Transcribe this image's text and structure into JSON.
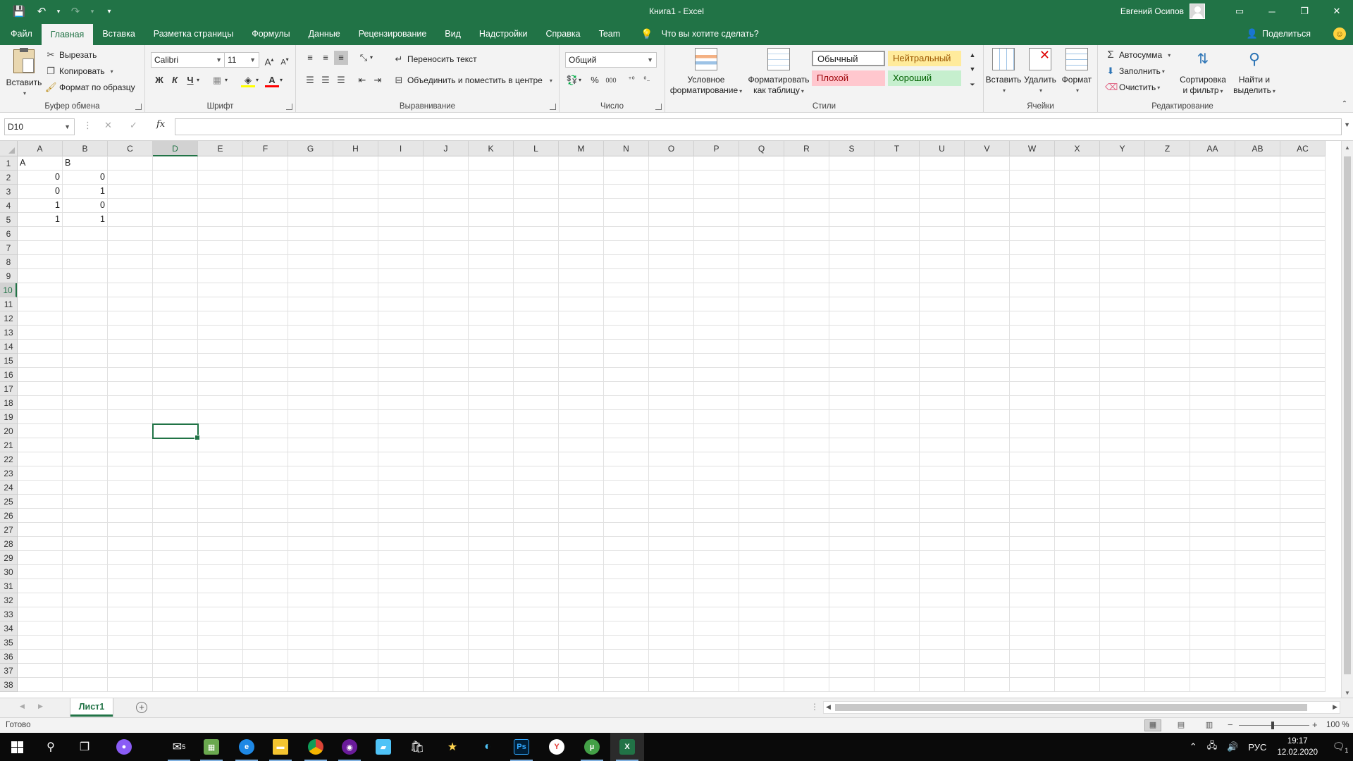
{
  "window": {
    "title": "Книга1  -  Excel",
    "user": "Евгений Осипов",
    "minimize": "─",
    "restore": "❐",
    "close": "✕",
    "ribbon_display": "▭"
  },
  "qat": {
    "save": "💾",
    "undo": "↶",
    "undo_dd": "▾",
    "redo": "↷",
    "redo_dd": "▾",
    "customize": "▾"
  },
  "tabs": [
    "Файл",
    "Главная",
    "Вставка",
    "Разметка страницы",
    "Формулы",
    "Данные",
    "Рецензирование",
    "Вид",
    "Надстройки",
    "Справка",
    "Team"
  ],
  "active_tab": "Главная",
  "tell_me": "Что вы хотите сделать?",
  "share": "Поделиться",
  "ribbon": {
    "clipboard": {
      "label": "Буфер обмена",
      "paste": "Вставить",
      "cut": "Вырезать",
      "copy": "Копировать",
      "format_painter": "Формат по образцу"
    },
    "font": {
      "label": "Шрифт",
      "name": "Calibri",
      "size": "11",
      "grow": "A",
      "shrink": "A",
      "bold": "Ж",
      "italic": "К",
      "underline": "Ч",
      "font_color_letter": "A"
    },
    "alignment": {
      "label": "Выравнивание",
      "wrap": "Переносить текст",
      "merge": "Объединить и поместить в центре"
    },
    "number": {
      "label": "Число",
      "format": "Общий",
      "percent": "%",
      "thousands": "000"
    },
    "styles": {
      "label": "Стили",
      "conditional": [
        "Условное",
        "форматирование"
      ],
      "as_table": [
        "Форматировать",
        "как таблицу"
      ],
      "normal": "Обычный",
      "neutral": "Нейтральный",
      "bad": "Плохой",
      "good": "Хороший",
      "colors": {
        "neutral_bg": "#ffeb9c",
        "neutral_fg": "#9c5700",
        "bad_bg": "#ffc7ce",
        "bad_fg": "#9c0006",
        "good_bg": "#c6efce",
        "good_fg": "#006100"
      }
    },
    "cells": {
      "label": "Ячейки",
      "insert": "Вставить",
      "delete": "Удалить",
      "format": "Формат"
    },
    "editing": {
      "label": "Редактирование",
      "autosum": "Автосумма",
      "fill": "Заполнить",
      "clear": "Очистить",
      "sort": [
        "Сортировка",
        "и фильтр"
      ],
      "find": [
        "Найти и",
        "выделить"
      ]
    }
  },
  "formula_bar": {
    "name_box": "D10",
    "fx": "fx",
    "value": ""
  },
  "columns": [
    "A",
    "B",
    "C",
    "D",
    "E",
    "F",
    "G",
    "H",
    "I",
    "J",
    "K",
    "L",
    "M",
    "N",
    "O",
    "P",
    "Q",
    "R",
    "S",
    "T",
    "U",
    "V",
    "W",
    "X",
    "Y",
    "Z",
    "AA",
    "AB",
    "AC"
  ],
  "selected_column": "D",
  "selected_row": 10,
  "row_count": 38,
  "cells": [
    {
      "row": 1,
      "col": 0,
      "value": "A",
      "num": false
    },
    {
      "row": 1,
      "col": 1,
      "value": "B",
      "num": false
    },
    {
      "row": 2,
      "col": 0,
      "value": "0",
      "num": true
    },
    {
      "row": 2,
      "col": 1,
      "value": "0",
      "num": true
    },
    {
      "row": 3,
      "col": 0,
      "value": "0",
      "num": true
    },
    {
      "row": 3,
      "col": 1,
      "value": "1",
      "num": true
    },
    {
      "row": 4,
      "col": 0,
      "value": "1",
      "num": true
    },
    {
      "row": 4,
      "col": 1,
      "value": "0",
      "num": true
    },
    {
      "row": 5,
      "col": 0,
      "value": "1",
      "num": true
    },
    {
      "row": 5,
      "col": 1,
      "value": "1",
      "num": true
    }
  ],
  "sheet_tab": "Лист1",
  "status": {
    "text": "Готово",
    "zoom": "100 %"
  },
  "taskbar": {
    "mail_badge": "5",
    "lang": "РУС",
    "time": "19:17",
    "date": "12.02.2020",
    "notif_badge": "1",
    "app_letters": {
      "ps": "Ps",
      "yandex": "Y",
      "excel": "X"
    }
  }
}
